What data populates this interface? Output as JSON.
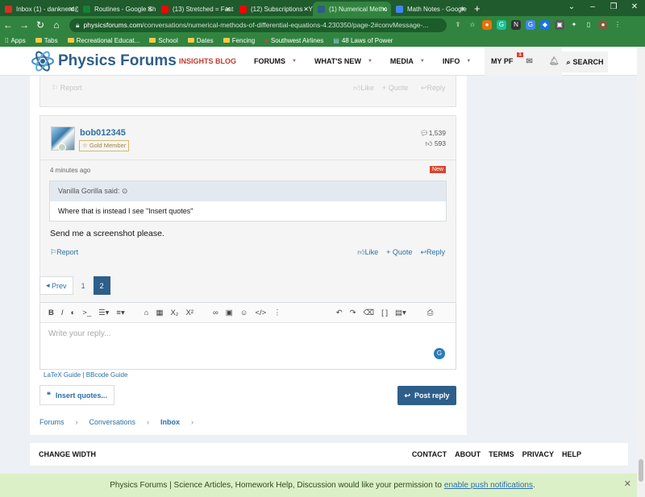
{
  "browser": {
    "tabs": [
      {
        "title": "Inbox (1) - danknerd@",
        "color": "#d93025",
        "active": false
      },
      {
        "title": "Routines - Google Sh",
        "color": "#188038",
        "active": false
      },
      {
        "title": "(13) Stretched = Fast",
        "color": "#ff0000",
        "active": false
      },
      {
        "title": "(12) Subscriptions - Y",
        "color": "#ff0000",
        "active": false
      },
      {
        "title": "(1) Numerical Metho",
        "color": "#2e5e86",
        "active": true
      },
      {
        "title": "Math Notes - Google",
        "color": "#4285f4",
        "active": false
      }
    ],
    "url_domain": "physicsforums.com",
    "url_path": "/conversations/numerical-methods-of-differential-equations-4.230350/page-2#convMessage-...",
    "bookmarks": [
      "Apps",
      "Tabs",
      "Recreational Educat...",
      "School",
      "Dates",
      "Fencing",
      "Southwest Airlines",
      "48 Laws of Power"
    ]
  },
  "site": {
    "logo": "Physics Forums",
    "nav": [
      "INSIGHTS BLOG",
      "FORUMS",
      "WHAT'S NEW",
      "MEDIA",
      "INFO"
    ],
    "my_pf": "MY PF",
    "alert_count": "1",
    "search": "SEARCH"
  },
  "prev_post": {
    "report": "Report",
    "like": "Like",
    "quote": "Quote",
    "reply": "Reply"
  },
  "post": {
    "username": "bob012345",
    "member_badge": "Gold Member",
    "messages_count": "1,539",
    "reaction_count": "593",
    "time": "4 minutes ago",
    "new_badge": "New",
    "quote_author": "Vanilla Gorilla said:",
    "quote_text": "Where that is instead I see \"Insert quotes\"",
    "message": "Send me a screenshot please.",
    "report": "Report",
    "like": "Like",
    "quote": "Quote",
    "reply": "Reply"
  },
  "pagination": {
    "prev": "Prev",
    "pages": [
      "1",
      "2"
    ],
    "current": "2"
  },
  "editor": {
    "placeholder": "Write your reply...",
    "latex_guide": "LaTeX Guide",
    "bbcode_guide": "BBcode Guide",
    "insert_quotes": "Insert quotes...",
    "post_reply": "Post reply"
  },
  "breadcrumbs": [
    "Forums",
    "Conversations",
    "Inbox"
  ],
  "footer": {
    "change_width": "CHANGE WIDTH",
    "links": [
      "CONTACT",
      "ABOUT",
      "TERMS",
      "PRIVACY",
      "HELP"
    ]
  },
  "push_notice": {
    "text": "Physics Forums | Science Articles, Homework Help, Discussion would like your permission to",
    "link": "enable push notifications",
    "end": "."
  }
}
